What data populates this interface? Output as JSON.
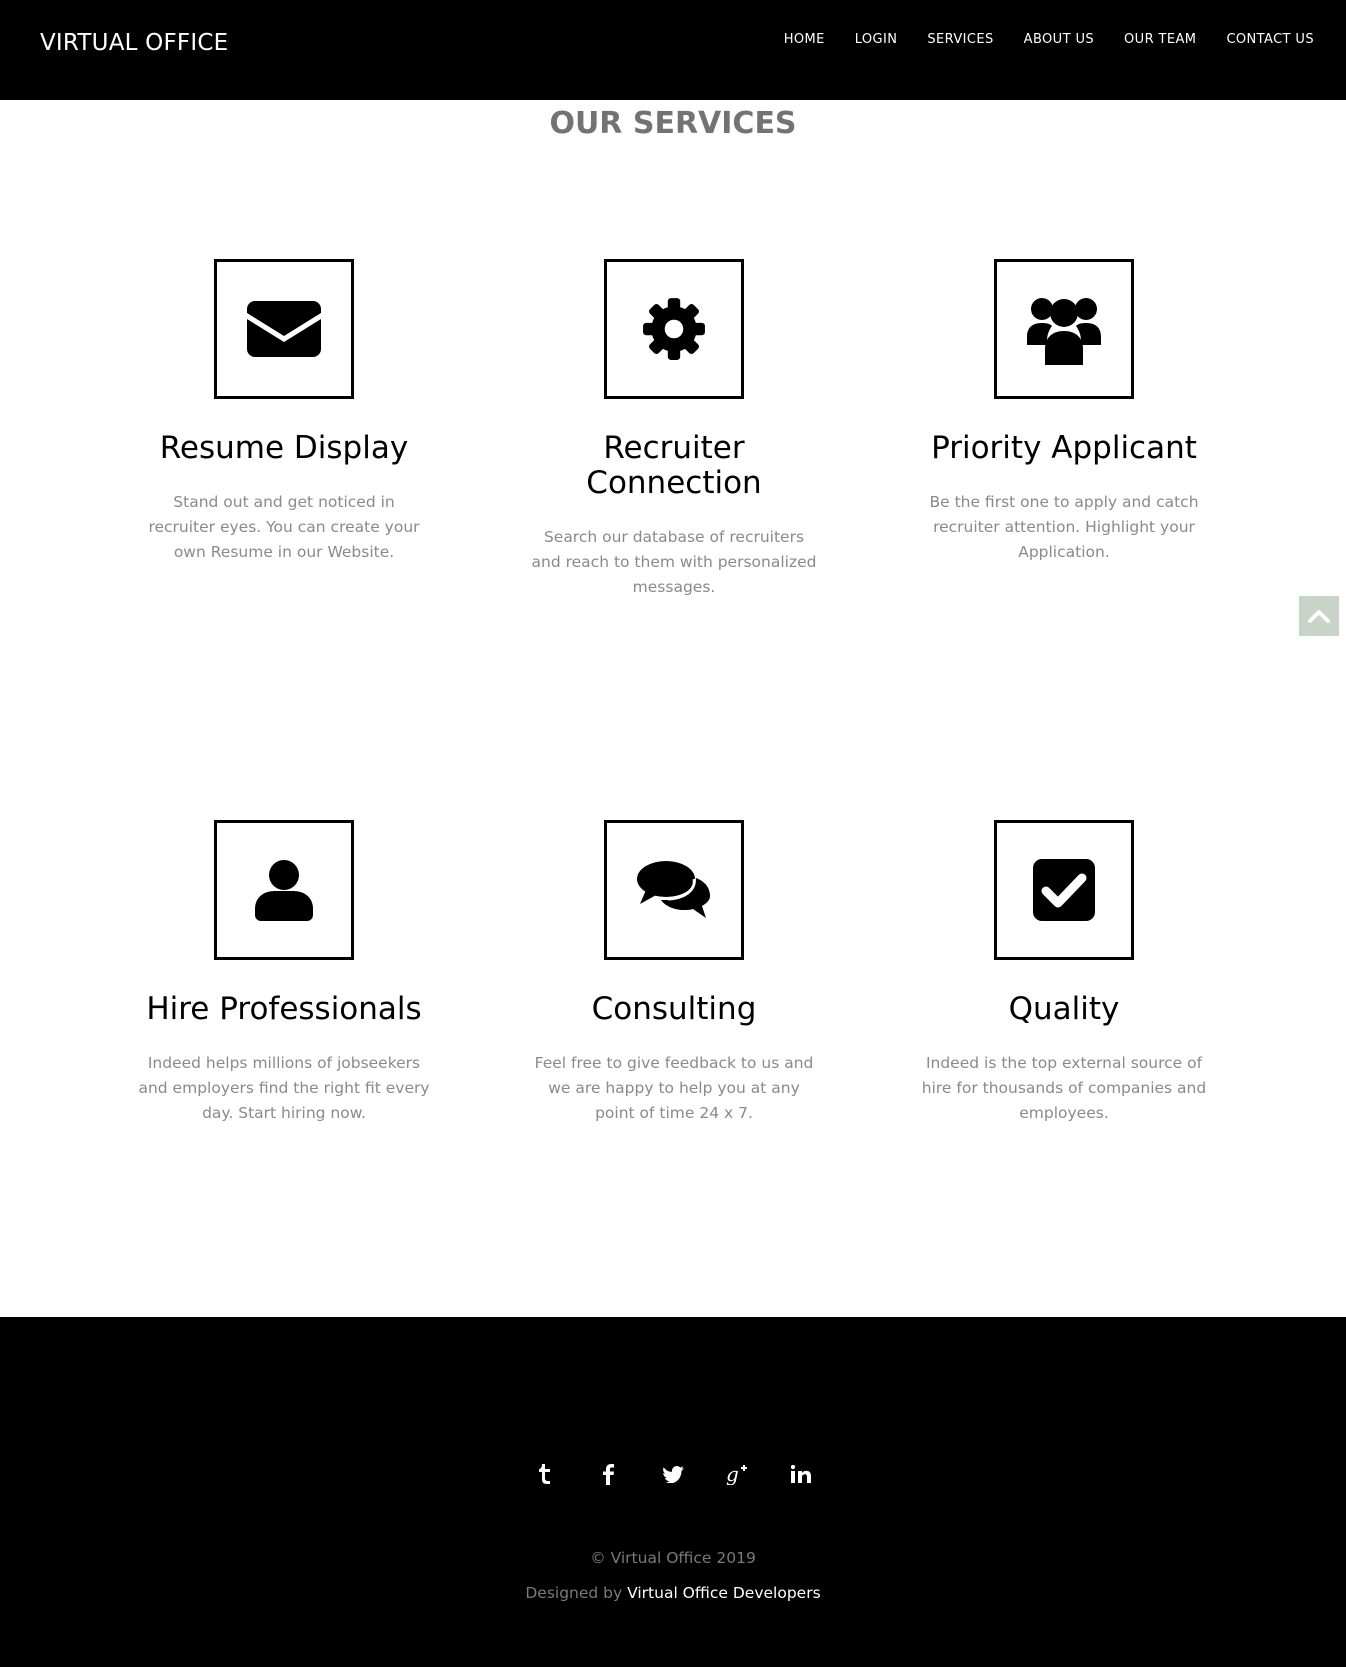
{
  "header": {
    "brand": "VIRTUAL OFFICE",
    "nav": [
      "HOME",
      "LOGIN",
      "SERVICES",
      "ABOUT US",
      "OUR TEAM",
      "CONTACT US"
    ]
  },
  "services": {
    "title": "OUR SERVICES",
    "items": [
      {
        "icon": "envelope-icon",
        "title": "Resume Display",
        "desc": "Stand out and get noticed in recruiter eyes. You can create your own Resume in our Website."
      },
      {
        "icon": "gear-icon",
        "title": "Recruiter Connection",
        "desc": "Search our database of recruiters and reach to them with personalized messages."
      },
      {
        "icon": "users-icon",
        "title": "Priority Applicant",
        "desc": "Be the first one to apply and catch recruiter attention. Highlight your Application."
      },
      {
        "icon": "user-icon",
        "title": "Hire Professionals",
        "desc": "Indeed helps millions of jobseekers and employers find the right fit every day. Start hiring now."
      },
      {
        "icon": "comments-icon",
        "title": "Consulting",
        "desc": "Feel free to give feedback to us and we are happy to help you at any point of time 24 x 7."
      },
      {
        "icon": "check-square-icon",
        "title": "Quality",
        "desc": "Indeed is the top external source of hire for thousands of companies and employees."
      }
    ]
  },
  "back_to_top": {
    "icon": "chevron-up-icon",
    "color": "#c8d4c8"
  },
  "footer": {
    "social": [
      "tumblr-icon",
      "facebook-icon",
      "twitter-icon",
      "google-plus-icon",
      "linkedin-icon"
    ],
    "copyright": "© Virtual Office 2019",
    "credits_prefix": "Designed by ",
    "credits_link": "Virtual Office Developers"
  }
}
